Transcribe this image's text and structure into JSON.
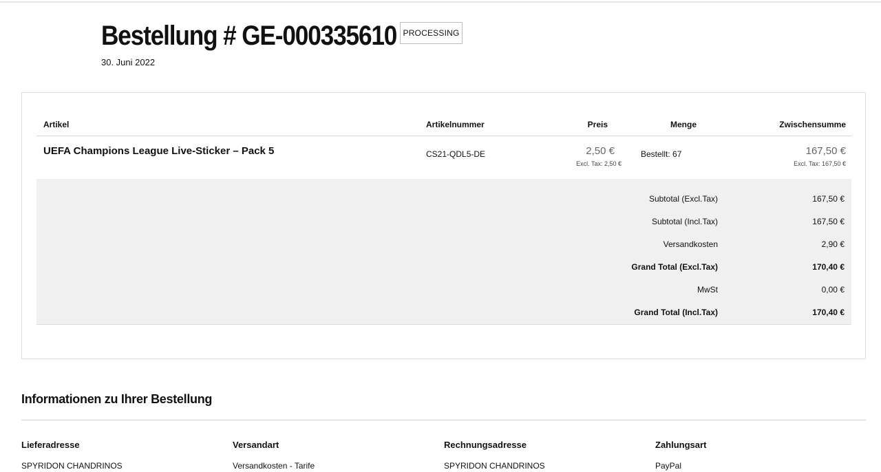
{
  "order": {
    "title": "Bestellung # GE-000335610",
    "status": "PROCESSING",
    "date": "30. Juni 2022"
  },
  "items_table": {
    "headers": {
      "article": "Artikel",
      "sku": "Artikelnummer",
      "price": "Preis",
      "qty": "Menge",
      "subtotal": "Zwischensumme"
    },
    "rows": [
      {
        "name": "UEFA Champions League Live-Sticker – Pack 5",
        "sku": "CS21-QDL5-DE",
        "price": "2,50 €",
        "price_excl": "Excl. Tax: 2,50 €",
        "qty": "Bestellt: 67",
        "subtotal": "167,50 €",
        "subtotal_excl": "Excl. Tax: 167,50 €"
      }
    ]
  },
  "totals": [
    {
      "label": "Subtotal (Excl.Tax)",
      "value": "167,50 €"
    },
    {
      "label": "Subtotal (Incl.Tax)",
      "value": "167,50 €"
    },
    {
      "label": "Versandkosten",
      "value": "2,90 €"
    },
    {
      "label": "Grand Total (Excl.Tax)",
      "value": "170,40 €"
    },
    {
      "label": "MwSt",
      "value": "0,00 €"
    },
    {
      "label": "Grand Total (Incl.Tax)",
      "value": "170,40 €"
    }
  ],
  "info": {
    "title": "Informationen zu Ihrer Bestellung",
    "columns": [
      {
        "heading": "Lieferadresse",
        "value": "SPYRIDON CHANDRINOS"
      },
      {
        "heading": "Versandart",
        "value": "Versandkosten - Tarife"
      },
      {
        "heading": "Rechnungsadresse",
        "value": "SPYRIDON CHANDRINOS"
      },
      {
        "heading": "Zahlungsart",
        "value": "PayPal"
      }
    ]
  }
}
